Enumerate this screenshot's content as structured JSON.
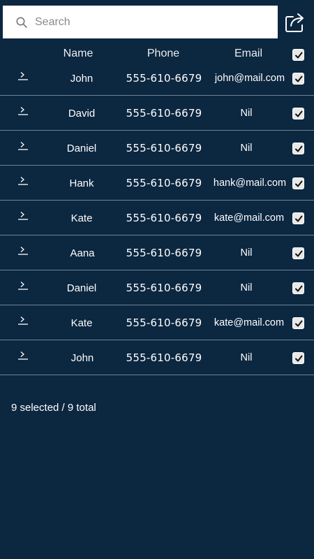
{
  "search": {
    "placeholder": "Search",
    "value": ""
  },
  "header": {
    "name": "Name",
    "phone": "Phone",
    "email": "Email",
    "select_all": true
  },
  "contacts": [
    {
      "name": "John",
      "phone": "555-610-6679",
      "email": "john@mail.com",
      "selected": true
    },
    {
      "name": "David",
      "phone": "555-610-6679",
      "email": "Nil",
      "selected": true
    },
    {
      "name": "Daniel",
      "phone": "555-610-6679",
      "email": "Nil",
      "selected": true
    },
    {
      "name": "Hank",
      "phone": "555-610-6679",
      "email": "hank@mail.com",
      "selected": true
    },
    {
      "name": "Kate",
      "phone": "555-610-6679",
      "email": "kate@mail.com",
      "selected": true
    },
    {
      "name": "Aana",
      "phone": "555-610-6679",
      "email": "Nil",
      "selected": true
    },
    {
      "name": "Daniel",
      "phone": "555-610-6679",
      "email": "Nil",
      "selected": true
    },
    {
      "name": "Kate",
      "phone": "555-610-6679",
      "email": "kate@mail.com",
      "selected": true
    },
    {
      "name": "John",
      "phone": "555-610-6679",
      "email": "Nil",
      "selected": true
    }
  ],
  "footer": {
    "summary": "9 selected / 9 total"
  },
  "icons": {
    "search": "search-icon",
    "share": "share-icon",
    "row_expand": "chevron-right-icon",
    "check": "checkmark-icon"
  },
  "colors": {
    "background": "#0c2740",
    "text": "#ffffff",
    "divider": "#6e8499",
    "search_bg": "#ffffff"
  }
}
